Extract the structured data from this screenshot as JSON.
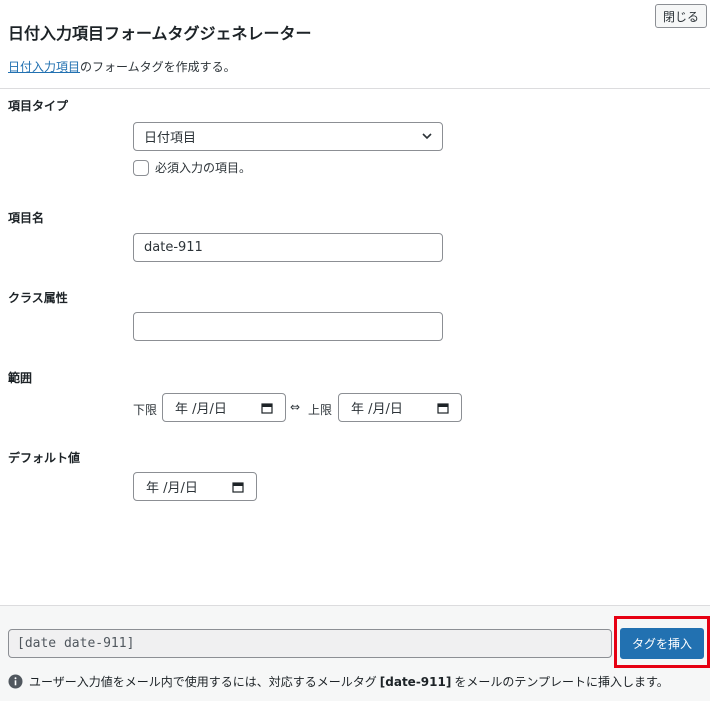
{
  "dialog": {
    "close_label": "閉じる",
    "title": "日付入力項目フォームタグジェネレーター",
    "description_link": "日付入力項目",
    "description_rest": "のフォームタグを作成する。"
  },
  "fields": {
    "type": {
      "label": "項目タイプ",
      "selected": "日付項目",
      "required_label": "必須入力の項目。"
    },
    "name": {
      "label": "項目名",
      "value": "date-911"
    },
    "class": {
      "label": "クラス属性",
      "value": ""
    },
    "range": {
      "label": "範囲",
      "min_label": "下限",
      "min_value": "年 /月/日",
      "arrow": "⇔",
      "max_label": "上限",
      "max_value": "年 /月/日"
    },
    "default": {
      "label": "デフォルト値",
      "value": "年 /月/日"
    }
  },
  "footer": {
    "tag": "[date date-911]",
    "insert_label": "タグを挿入",
    "note_before": "ユーザー入力値をメール内で使用するには、対応するメールタグ",
    "note_tag": "[date-911]",
    "note_after": "をメールのテンプレートに挿入します。"
  },
  "colors": {
    "accent": "#2271b1",
    "highlight": "#e60012"
  },
  "icons": [
    "chevron-down-icon",
    "calendar-icon",
    "info-icon"
  ]
}
